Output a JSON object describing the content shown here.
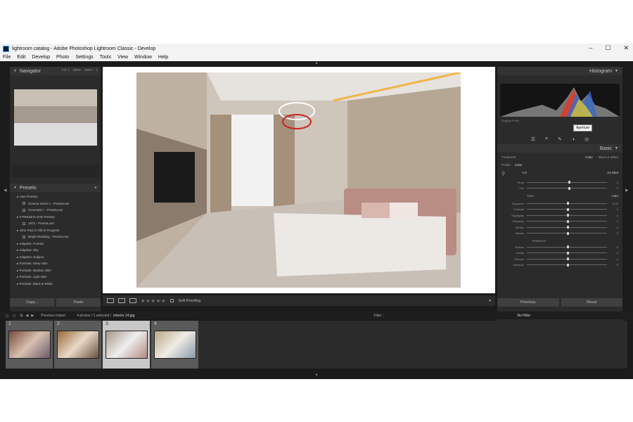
{
  "window": {
    "title": "lightroom catalog - Adobe Photoshop Lightroom Classic - Develop",
    "controls": [
      "–",
      "☐",
      "✕"
    ]
  },
  "menu": [
    "File",
    "Edit",
    "Develop",
    "Photo",
    "Settings",
    "Tools",
    "View",
    "Window",
    "Help"
  ],
  "navigator": {
    "title": "Navigator",
    "zoom_options": [
      "FIT ‡",
      "100%",
      "300%",
      "‡"
    ]
  },
  "presets": {
    "title": "Presets",
    "add": "+",
    "items": [
      {
        "label": "User Presets",
        "level": 0
      },
      {
        "label": "Cinema Stock 2 - PresetLove",
        "level": 1
      },
      {
        "label": "Cinematic I - PresetLove",
        "level": 1
      },
      {
        "label": "# PRESETLOVE Presets",
        "level": 0
      },
      {
        "label": "1972 - PresetLove",
        "level": 1
      },
      {
        "label": "John Paul O Old in Progress",
        "level": 0
      },
      {
        "label": "Bright Wedding - PresetLove",
        "level": 1
      },
      {
        "label": "Adaptive: Portrait",
        "level": 0
      },
      {
        "label": "Adaptive: Sky",
        "level": 0
      },
      {
        "label": "Adaptive: Subject",
        "level": 0
      },
      {
        "label": "Portraits: Deep Skin",
        "level": 0
      },
      {
        "label": "Portraits: Medium Skin",
        "level": 0
      },
      {
        "label": "Portraits: Light Skin",
        "level": 0
      },
      {
        "label": "Portraits: Black & White",
        "level": 0
      }
    ]
  },
  "left_buttons": {
    "copy": "Copy...",
    "paste": "Paste"
  },
  "toolbar": {
    "soft_proofing": "Soft Proofing",
    "stars": "★★★★★"
  },
  "histogram": {
    "title": "Histogram",
    "original_photo": "Original Photo"
  },
  "tooltip": "Aperture",
  "basic": {
    "title": "Basic",
    "treatment_label": "Treatment",
    "treatment_color": "Color",
    "treatment_bw": "Black & White",
    "profile_label": "Profile",
    "profile_value": "Color",
    "wb_label": "WB",
    "wb_value": "As Shot",
    "sliders_top": [
      {
        "label": "Temp",
        "pos": 0.52,
        "val": "0"
      },
      {
        "label": "Tint",
        "pos": 0.52,
        "val": "0"
      }
    ],
    "tone_label": "Tone",
    "auto_label": "Auto",
    "sliders_tone": [
      {
        "label": "Exposure",
        "pos": 0.5,
        "val": "0.00"
      },
      {
        "label": "Contrast",
        "pos": 0.5,
        "val": "0"
      },
      {
        "label": "Highlights",
        "pos": 0.5,
        "val": "0"
      },
      {
        "label": "Shadows",
        "pos": 0.5,
        "val": "0"
      },
      {
        "label": "Whites",
        "pos": 0.5,
        "val": "0"
      },
      {
        "label": "Blacks",
        "pos": 0.5,
        "val": "0"
      }
    ],
    "presence_label": "Presence",
    "sliders_presence": [
      {
        "label": "Texture",
        "pos": 0.5,
        "val": "0"
      },
      {
        "label": "Clarity",
        "pos": 0.5,
        "val": "0"
      },
      {
        "label": "Dehaze",
        "pos": 0.5,
        "val": "0"
      },
      {
        "label": "Vibrance",
        "pos": 0.5,
        "val": "0"
      }
    ]
  },
  "right_buttons": {
    "previous": "Previous",
    "reset": "Reset"
  },
  "filmstrip_bar": {
    "source": "Previous Import",
    "count": "4 photos / 1 selected /",
    "filename": "interior 14.jpg",
    "filter_label": "Filter :",
    "filter_value": "No Filter"
  },
  "filmstrip": [
    {
      "num": "1",
      "selected": false
    },
    {
      "num": "2",
      "selected": false
    },
    {
      "num": "3",
      "selected": true
    },
    {
      "num": "4",
      "selected": false
    }
  ]
}
